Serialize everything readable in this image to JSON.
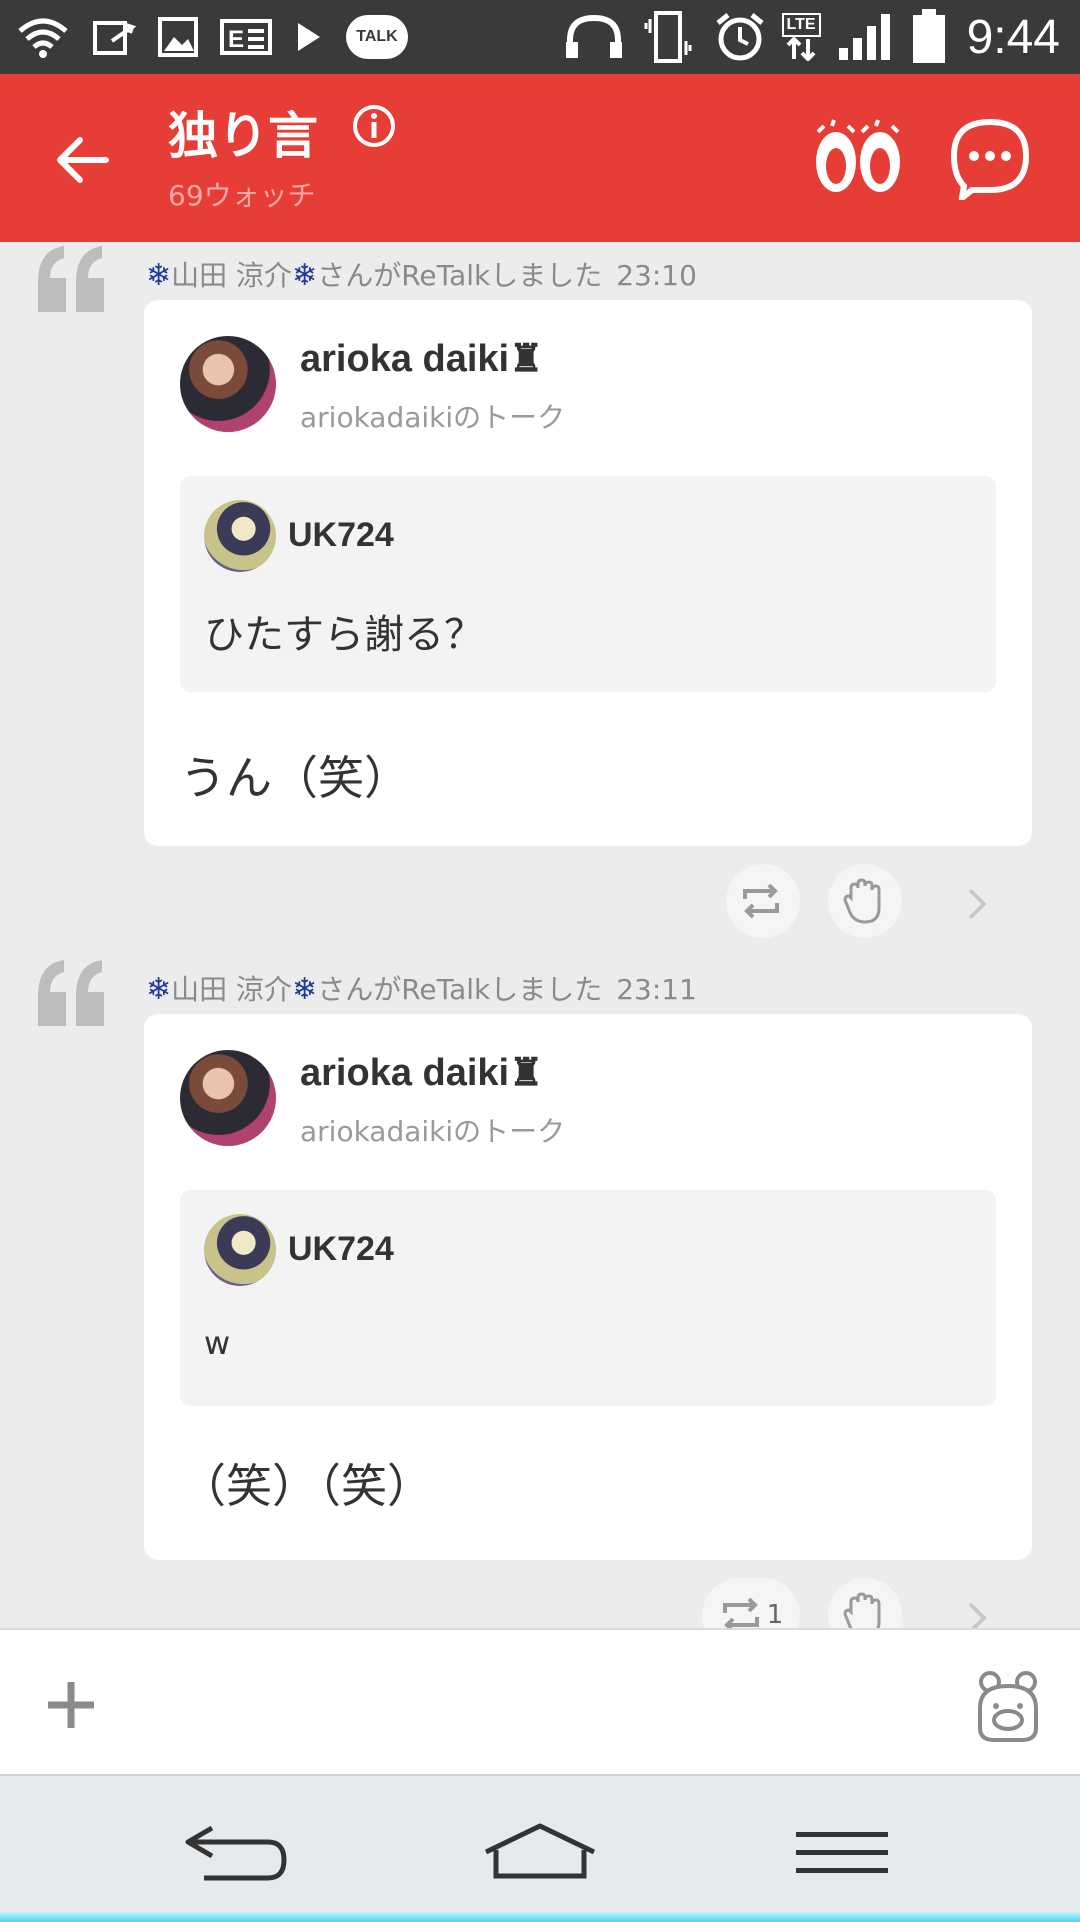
{
  "status_bar": {
    "talk_badge": "TALK",
    "lte_label": "LTE",
    "time": "9:44",
    "icons": [
      "wifi-icon",
      "photo-share-icon",
      "image-icon",
      "news-icon",
      "play-icon",
      "talk-icon",
      "headphones-icon",
      "vibrate-icon",
      "alarm-icon",
      "lte-icon",
      "signal-icon",
      "battery-icon"
    ]
  },
  "header": {
    "title": "独り言",
    "watch_count": "69ウォッチ",
    "accent_color": "#e73d37"
  },
  "posts": [
    {
      "retalk_user": "山田 涼介",
      "snow_left": "❄",
      "snow_right": "❄",
      "retalk_suffix": "さんがReTalkしました",
      "time": "23:10",
      "author": "arioka daiki♜",
      "talk_name": "ariokadaikiのトーク",
      "quoted_user": "UK724",
      "quoted_text": "ひたすら謝る？",
      "text": "うん（笑）",
      "retalk_count": ""
    },
    {
      "retalk_user": "山田 涼介",
      "snow_left": "❄",
      "snow_right": "❄",
      "retalk_suffix": "さんがReTalkしました",
      "time": "23:11",
      "author": "arioka daiki♜",
      "talk_name": "ariokadaikiのトーク",
      "quoted_user": "UK724",
      "quoted_text": "w",
      "text": "（笑）（笑）",
      "retalk_count": "1"
    }
  ],
  "input_bar": {
    "icons": [
      "plus-icon",
      "sticker-icon"
    ]
  },
  "nav_bar": {
    "icons": [
      "back-icon",
      "home-icon",
      "menu-icon"
    ]
  }
}
